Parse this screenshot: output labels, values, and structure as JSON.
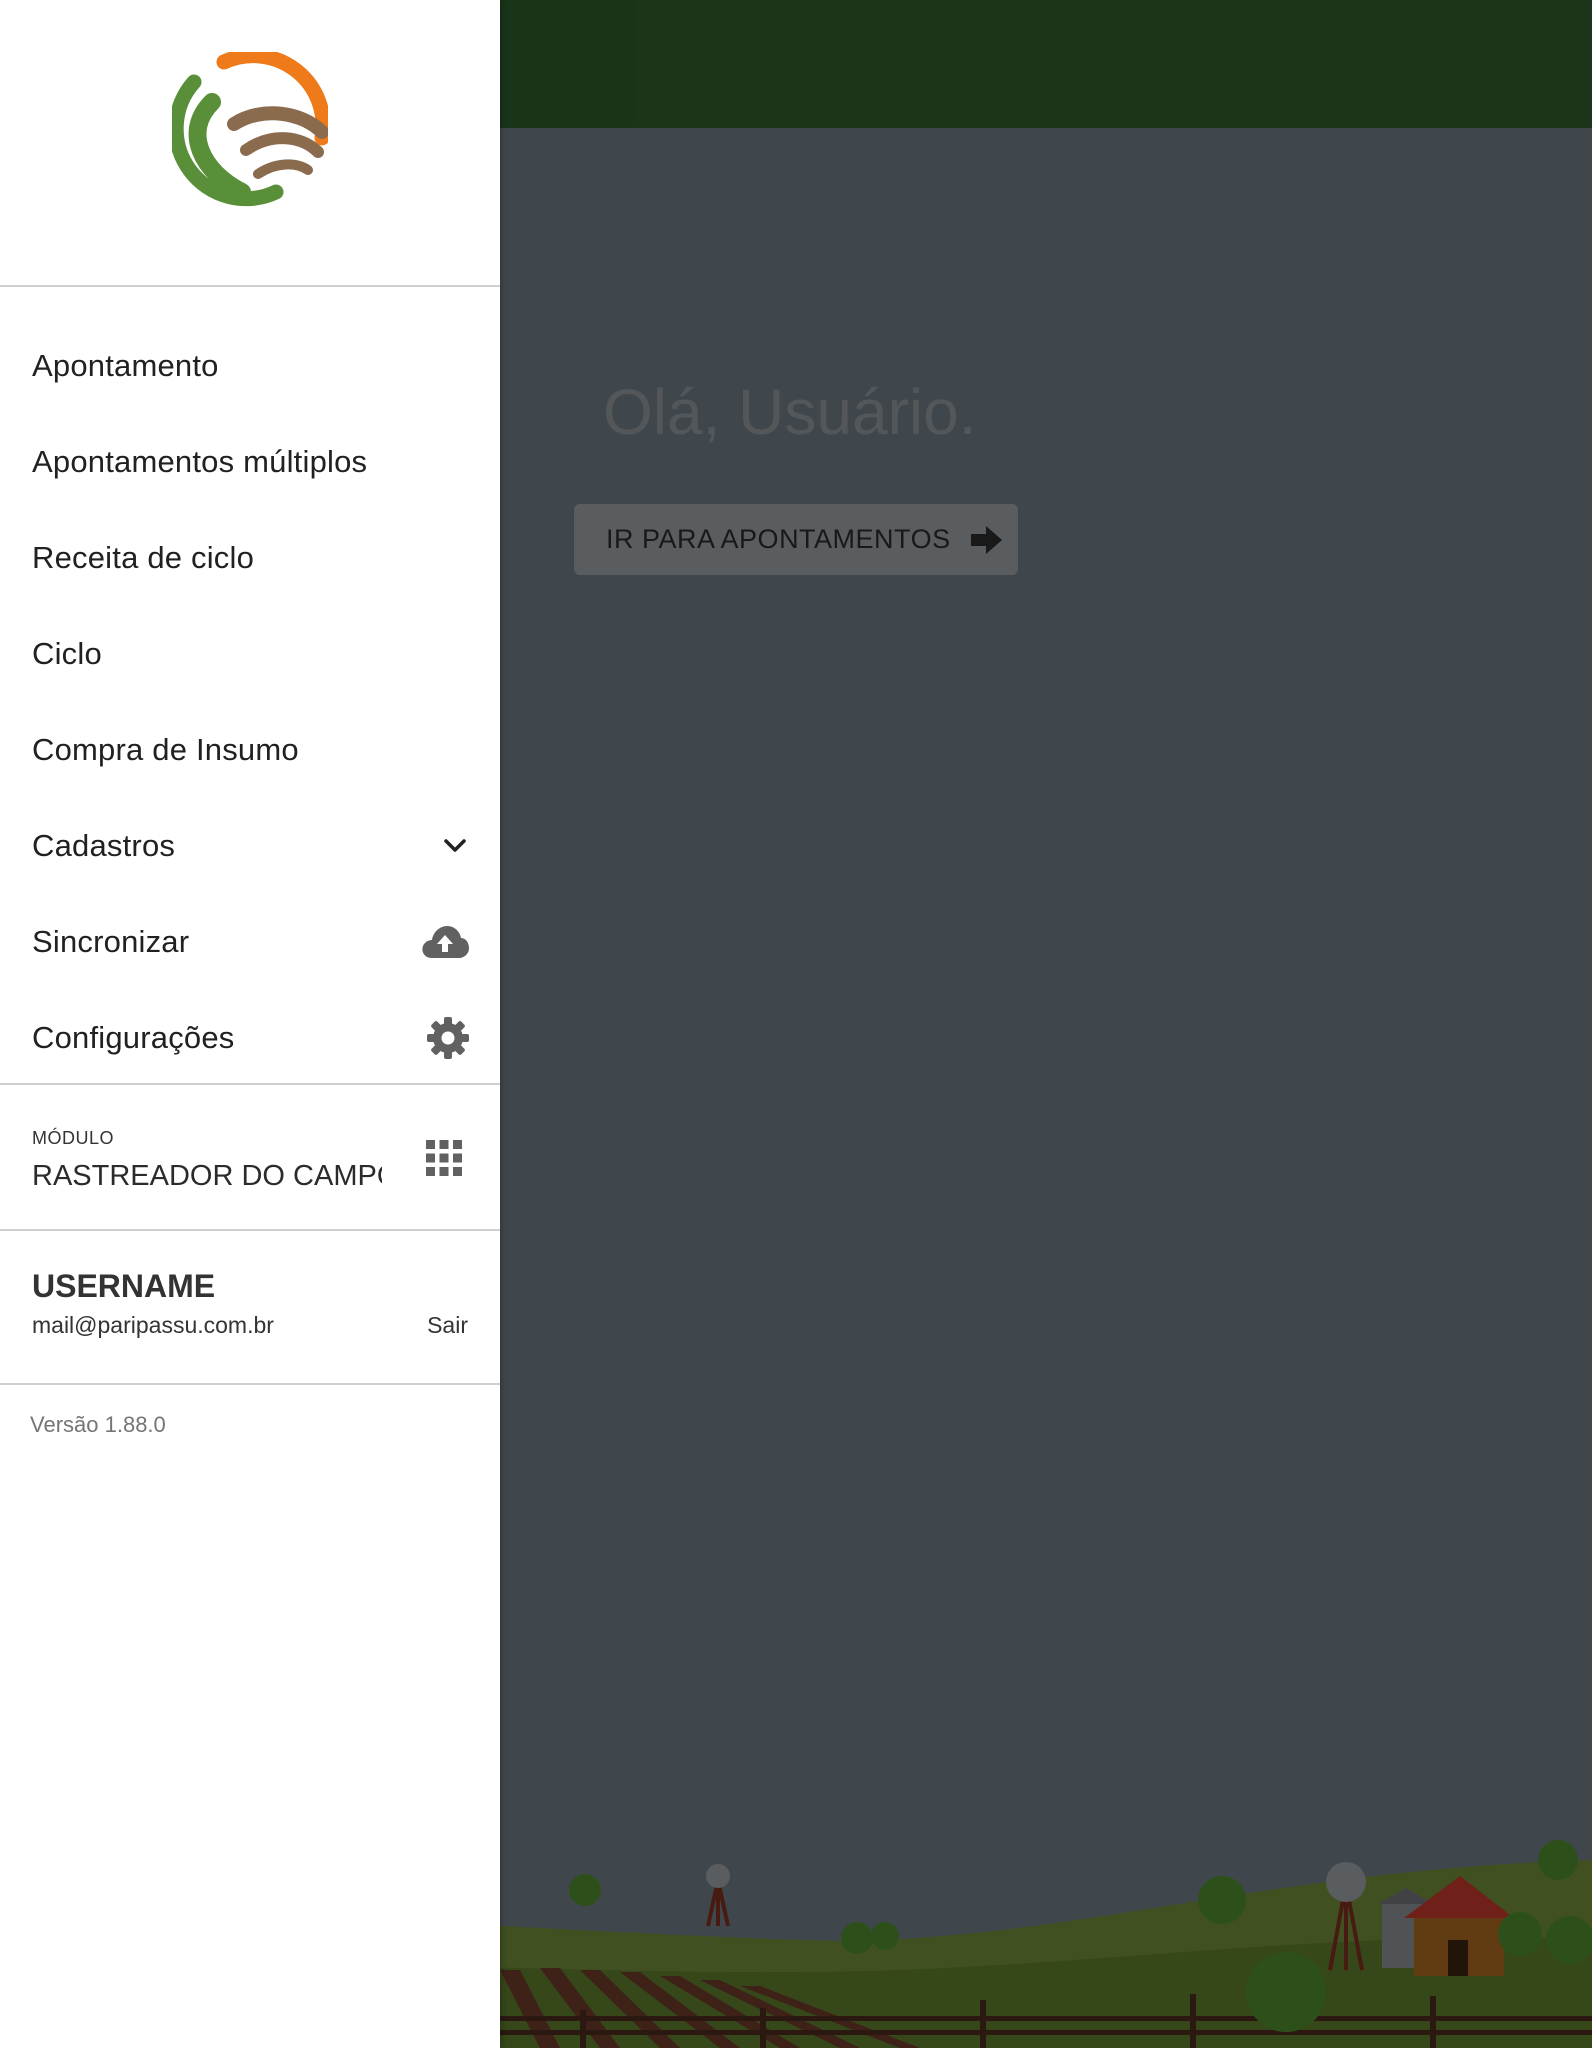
{
  "app": {
    "greeting": "Olá, Usuário.",
    "goto_button_label": "IR PARA APONTAMENTOS",
    "topbar_color": "#2e5a2d",
    "background_color": "#6f7b83"
  },
  "drawer": {
    "logo": "paripassu-logo",
    "menu": [
      {
        "label": "Apontamento"
      },
      {
        "label": "Apontamentos múltiplos"
      },
      {
        "label": "Receita de ciclo"
      },
      {
        "label": "Ciclo"
      },
      {
        "label": "Compra de Insumo"
      },
      {
        "label": "Cadastros",
        "icon": "chevron-down-icon"
      },
      {
        "label": "Sincronizar",
        "icon": "cloud-upload-icon"
      },
      {
        "label": "Configurações",
        "icon": "gear-icon"
      }
    ],
    "module": {
      "caption": "MÓDULO",
      "name": "RASTREADOR DO CAMPO",
      "icon": "apps-grid-icon"
    },
    "user": {
      "name": "USERNAME",
      "email": "mail@paripassu.com.br",
      "logout_label": "Sair"
    },
    "version": "Versão 1.88.0"
  }
}
